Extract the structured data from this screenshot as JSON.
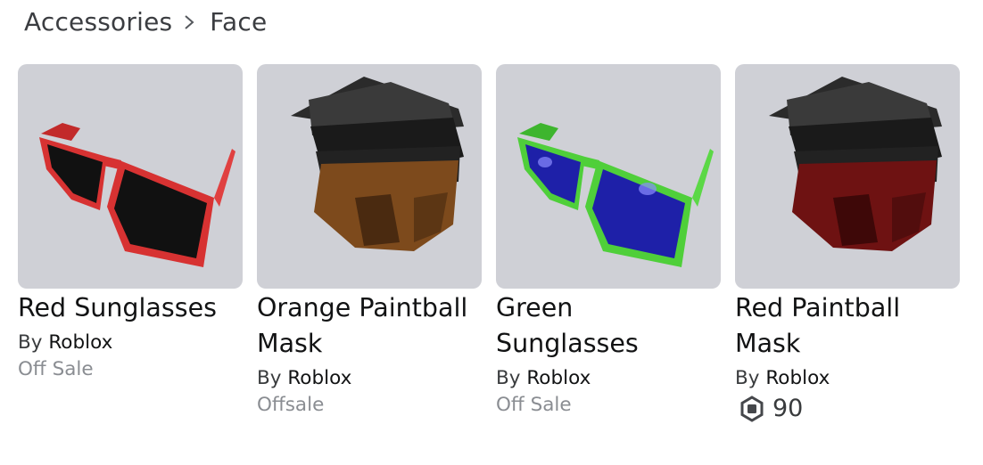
{
  "breadcrumb": {
    "parent": "Accessories",
    "current": "Face"
  },
  "items": [
    {
      "name": "Red Sunglasses",
      "by_label": "By",
      "creator": "Roblox",
      "price_text": "Off Sale",
      "icon": "red-sunglasses"
    },
    {
      "name": "Orange Paintball Mask",
      "by_label": "By",
      "creator": "Roblox",
      "price_text": "Offsale",
      "icon": "orange-paintball-mask"
    },
    {
      "name": "Green Sunglasses",
      "by_label": "By",
      "creator": "Roblox",
      "price_text": "Off Sale",
      "icon": "green-sunglasses"
    },
    {
      "name": "Red Paintball Mask",
      "by_label": "By",
      "creator": "Roblox",
      "price_value": "90",
      "currency_icon": "robux-icon",
      "icon": "red-paintball-mask"
    }
  ],
  "colors": {
    "thumb_bg": "#cfd0d6",
    "red_frame": "#d73232",
    "green_frame": "#4fcf3a",
    "blue_lens": "#1e20a8",
    "orange_mask": "#7d4a1c",
    "red_mask": "#6e1212"
  }
}
